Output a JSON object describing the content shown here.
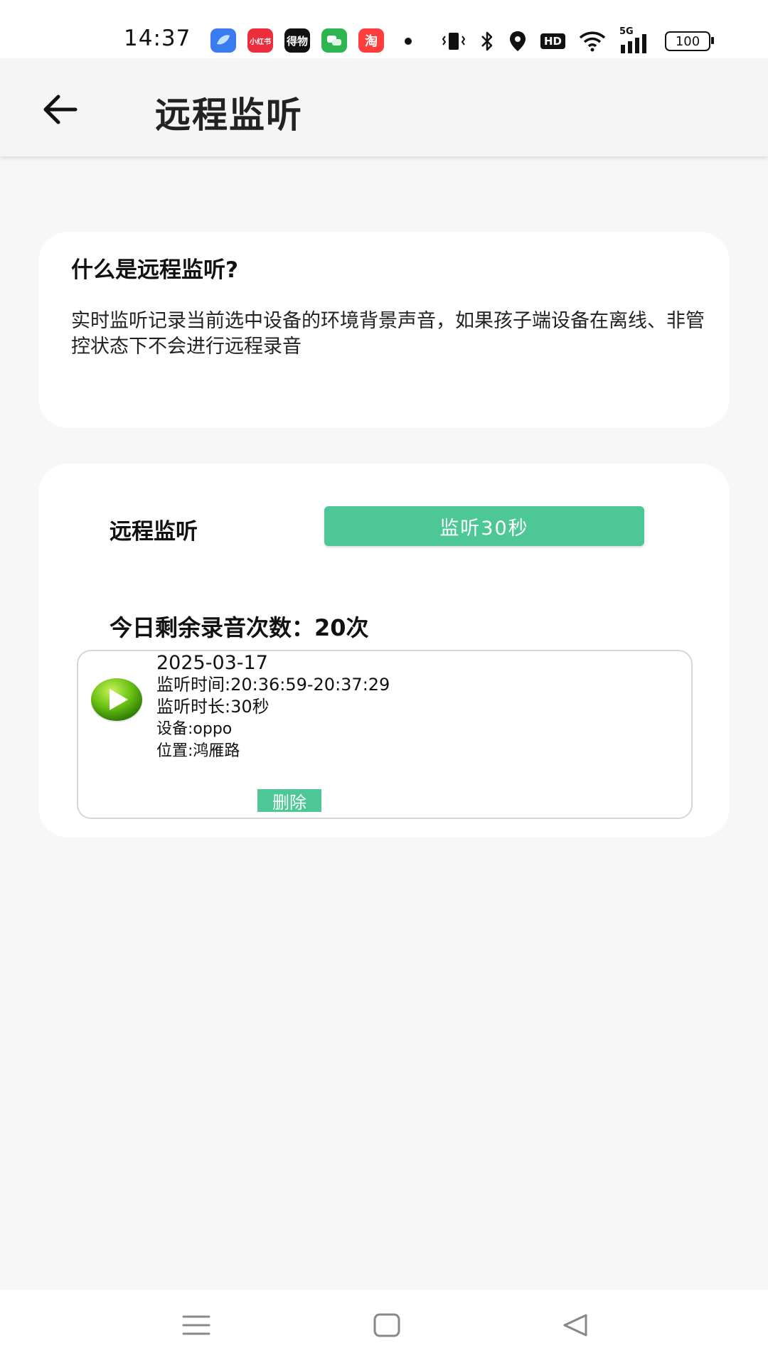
{
  "status_bar": {
    "time": "14:37",
    "app_icons": [
      {
        "name": "feishu-icon",
        "label": "",
        "color": "#3a7bf0"
      },
      {
        "name": "xiaohongshu-icon",
        "label": "小红书",
        "color": "#ec2d3c"
      },
      {
        "name": "dewu-icon",
        "label": "得物",
        "color": "#111111"
      },
      {
        "name": "wechat-icon",
        "label": "",
        "color": "#2fb550"
      },
      {
        "name": "taobao-icon",
        "label": "淘",
        "color": "#ff3d3d"
      }
    ],
    "network": "5G",
    "hd": "HD",
    "battery": "100"
  },
  "header": {
    "title": "远程监听"
  },
  "info_card": {
    "title": "什么是远程监听?",
    "description": "实时监听记录当前选中设备的环境背景声音，如果孩子端设备在离线、非管控状态下不会进行远程录音"
  },
  "monitor_card": {
    "label": "远程监听",
    "button_label": "监听30秒",
    "remaining": "今日剩余录音次数：20次"
  },
  "records": [
    {
      "date": "2025-03-17",
      "time_range": "监听时间:20:36:59-20:37:29",
      "duration": "监听时长:30秒",
      "device": "设备:oppo",
      "location": "位置:鸿雁路",
      "delete_label": "删除"
    }
  ],
  "colors": {
    "accent": "#4cc795",
    "background": "#f7f7f7",
    "card": "#ffffff"
  }
}
